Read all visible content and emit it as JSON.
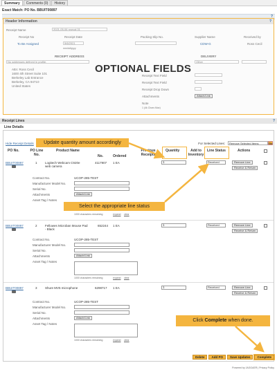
{
  "tabs": [
    "Summary",
    "Comments (0)",
    "History"
  ],
  "exact_match": "Exact Match: PO No. BBUIT00897",
  "header_info": {
    "title": "Header Information",
    "receipt_name_label": "Receipt Name",
    "receipt_name_value": "2021-05-06 rcsrval 01",
    "col_receipt_no": "Receipt No",
    "col_receipt_date": "Receipt Date",
    "col_packing_slip": "Packing Slip No.",
    "col_supplier": "Supplier Name",
    "col_received_by": "Received by",
    "receipt_no_value": "To Be Assigned",
    "receipt_date_value": "5/6/2021",
    "receipt_date_format": "mm/dd/yyyy",
    "supplier_value": "CDW-G",
    "received_by_value": "Ross Cecil",
    "receipt_address_label": "RECEIPT ADDRESS",
    "delivery_label": "DELIVERY",
    "address_placeholder": "No addresses defined in profile.",
    "address_lines": [
      "Attn: Ross Cecil",
      "1600 4th Street Suite 101",
      "Berkeley Lab Entrance",
      "Berkeley, CA 94710",
      "United States"
    ],
    "delivery_select": "Other",
    "delivery_fields": [
      "Receipt Text Field",
      "Receipt Text Field",
      "Receipt Drop Down",
      "Attachments",
      "Note"
    ],
    "attach_btn": "Attach/Link",
    "note_hint": "1 (4k Chars Max)"
  },
  "optional_label": "OPTIONAL FIELDS",
  "receipt_lines_title": "Receipt Lines",
  "line_details_tab": "Line Details",
  "hide_receipt_details": "Hide Receipt Details",
  "for_selected_lines": "For Selected Lines:",
  "for_selected_select": "Remove Selected Items",
  "go_btn": "Go",
  "columns": {
    "po_no": "PO No.",
    "po_line_no": "PO Line No.",
    "product_name": "Product Name",
    "catalog_no": "No.",
    "ordered": "Ordered",
    "previous_receipts": "Previous Receipts",
    "quantity": "Quantity",
    "add_to_inventory": "Add to Inventory",
    "line_status": "Line Status",
    "actions": "Actions"
  },
  "lines": [
    {
      "po": "BBUIT00897",
      "line": "1",
      "product": "Logitech Webcam C920e web camera",
      "catalog": "4117907",
      "ordered": "1 EA",
      "qty": "1",
      "status": "Received",
      "contract_no": "UCOP-285-TEST",
      "remove_btn": "Remove Line",
      "receive_return_btn": "Receive & Return"
    },
    {
      "po": "BBUIT00897",
      "line": "2",
      "product": "Fellowes Microban Mouse Pad - Black",
      "catalog": "652244",
      "ordered": "1 EA",
      "qty": "1",
      "status": "Received",
      "contract_no": "UCOP-285-TEST",
      "remove_btn": "Remove Line",
      "receive_return_btn": "Receive & Return"
    },
    {
      "po": "BBUIT00897",
      "line": "3",
      "product": "Shure MV5 microphone",
      "catalog": "6298717",
      "ordered": "1 EA",
      "qty": "1",
      "status": "Received",
      "contract_no": "UCOP-285-TEST",
      "remove_btn": "Remove Line",
      "receive_return_btn": "Receive & Return"
    }
  ],
  "detail_labels": {
    "contract_no": "Contract No.",
    "manufacturer_model": "Manufacturer Model No.",
    "serial_no": "Serial No.",
    "attachments": "Attachments",
    "asset_tag": "Asset Tag / Notes",
    "attach_btn": "Attach/Link",
    "chars_remaining": "1000 characters remaining",
    "expand": "expand",
    "clear": "clear"
  },
  "callouts": {
    "update_qty": "Update quantity amount accordingly",
    "line_status": "Select the appropriate line status",
    "complete_pre": "Click ",
    "complete_bold": "Complete",
    "complete_post": " when done."
  },
  "bottom_buttons": [
    "Delete",
    "Add PO",
    "Save Updates",
    "Complete"
  ],
  "footer": "Powered by JAGGAER | Privacy Policy",
  "colors": {
    "accent": "#f4b53f",
    "link": "#3a6ea5"
  }
}
